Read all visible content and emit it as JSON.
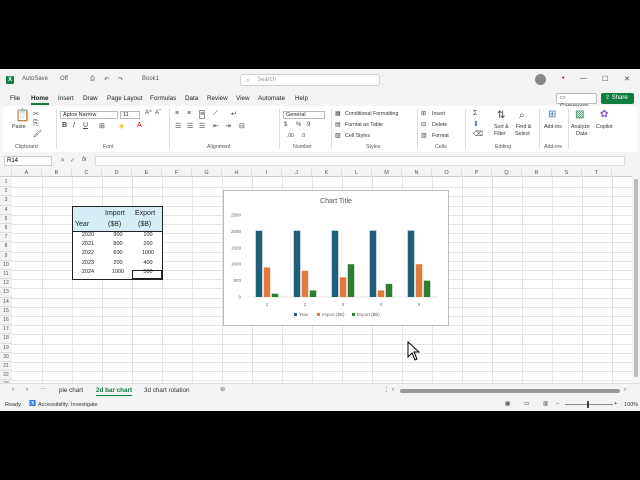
{
  "window": {
    "filename": "Book1",
    "autosave": "AutoSave",
    "toggle": "Off",
    "status": "Saved",
    "search_placeholder": "Search"
  },
  "menu": [
    "File",
    "Home",
    "Insert",
    "Draw",
    "Page Layout",
    "Formulas",
    "Data",
    "Review",
    "View",
    "Automate",
    "Help"
  ],
  "menu_active": "Home",
  "comments_label": "Comments",
  "share_label": "Share",
  "ribbon": {
    "clipboard": {
      "label": "Clipboard",
      "paste": "Paste"
    },
    "font": {
      "label": "Font",
      "name": "Aptos Narrow",
      "size": "11",
      "bold": "B",
      "italic": "I",
      "underline": "U"
    },
    "alignment": {
      "label": "Alignment"
    },
    "number": {
      "label": "Number",
      "format": "General",
      "currency": "$",
      "percent": "%",
      "comma": "9"
    },
    "styles": {
      "label": "Styles",
      "conditional": "Conditional Formatting",
      "format_table": "Format as Table",
      "cell_styles": "Cell Styles"
    },
    "cells": {
      "label": "Cells",
      "insert": "Insert",
      "delete": "Delete",
      "format": "Format"
    },
    "editing": {
      "label": "Editing",
      "sort": "Sort &",
      "filter": "Filter",
      "find": "Find &",
      "select": "Select"
    },
    "addins": {
      "label": "Add-ins",
      "btn": "Add-ins"
    },
    "analyze": "Analyze",
    "data": "Data",
    "copilot": "Copilot"
  },
  "formula": {
    "namebox": "R14",
    "fx": "fx"
  },
  "columns": [
    "A",
    "B",
    "C",
    "D",
    "E",
    "F",
    "G",
    "H",
    "I",
    "J",
    "K",
    "L",
    "M",
    "N",
    "O",
    "P",
    "Q",
    "R",
    "S",
    "T"
  ],
  "rows": [
    "1",
    "2",
    "3",
    "4",
    "5",
    "6",
    "7",
    "8",
    "9",
    "10",
    "11",
    "12",
    "13",
    "14",
    "15",
    "16",
    "17",
    "18",
    "19",
    "20",
    "21",
    "22",
    "23"
  ],
  "table": {
    "headers": {
      "year": "Year",
      "import1": "Import",
      "import2": "($B)",
      "export1": "Export",
      "export2": "($B)"
    },
    "rows": [
      [
        "2020",
        "900",
        "100"
      ],
      [
        "2021",
        "800",
        "200"
      ],
      [
        "2022",
        "600",
        "1000"
      ],
      [
        "2023",
        "200",
        "400"
      ],
      [
        "2024",
        "1000",
        "500"
      ]
    ]
  },
  "chart_data": {
    "type": "bar",
    "title": "Chart Title",
    "categories": [
      "1",
      "2",
      "3",
      "4",
      "5"
    ],
    "series": [
      {
        "name": "Year",
        "values": [
          2020,
          2021,
          2022,
          2023,
          2024
        ],
        "color": "#1f5f7a"
      },
      {
        "name": "Import ($B)",
        "values": [
          900,
          800,
          600,
          200,
          1000
        ],
        "color": "#e07a3e"
      },
      {
        "name": "Export ($B)",
        "values": [
          100,
          200,
          1000,
          400,
          500
        ],
        "color": "#2e7d32"
      }
    ],
    "ylim": [
      0,
      2500
    ],
    "yticks": [
      "0",
      "500",
      "1000",
      "1500",
      "2000",
      "2500"
    ],
    "legend": "bottom",
    "grid": false
  },
  "sheets": [
    "pie chart",
    "2d bar chart",
    "3d chart rotation"
  ],
  "active_sheet": "2d bar chart",
  "status": {
    "ready": "Ready",
    "accessibility": "Accessibility: Investigate",
    "zoom": "100%"
  }
}
